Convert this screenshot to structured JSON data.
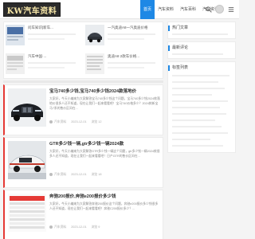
{
  "header": {
    "logo_text": "KW汽车资料",
    "nav": [
      {
        "label": "首页",
        "active": true
      },
      {
        "label": "汽车资料",
        "active": false
      },
      {
        "label": "汽车百科",
        "active": false
      },
      {
        "label": "汽车资讯",
        "active": false
      }
    ],
    "icons": [
      "search-icon",
      "avatar",
      "menu-icon"
    ]
  },
  "top_cards": [
    {
      "title": "问车知识|新车..."
    },
    {
      "title": "一汽奥迪A8一汽奥迪价格"
    },
    {
      "title": "汽车中国·..."
    },
    {
      "title": "奥迪A8 2款车价格..."
    }
  ],
  "articles": [
    {
      "title": "宝马740多少钱,宝马740多少钱2024款落地价",
      "excerpt": "大家好，今天小编来为大家解答宝马740多少钱这个问题，宝马740多少钱2024款落地价很多人还不知道，现在让我们一起来看看吧！宝马740价格多少？2024款新宝马7系的售价区间在...",
      "meta": [
        "汽车资料",
        "2023-12-01",
        "浏览 12"
      ]
    },
    {
      "title": "GTR多少钱一辆,gtr多少钱一辆2024款",
      "excerpt": "大家好，今天小编来为大家解答GTR多少钱一辆这个问题，gtr多少钱一辆2024款很多人还不知道，现在让我们一起来看看吧！日产GTR的售价区间在...",
      "meta": [
        "汽车资料",
        "2023-12-01",
        "浏览 18"
      ]
    },
    {
      "title": "奔驰200报价,奔驰e200报价多少钱",
      "excerpt": "大家好，今天小编来为大家解答奔驰200报价这个问题，奔驰e200报价多少钱很多人还不知道，现在让我们一起来看看吧！奔驰C200报价多少？...",
      "meta": [
        "汽车资料",
        "2023-12-01",
        "浏览 9"
      ]
    }
  ],
  "sidebar": {
    "boxes": [
      {
        "title": "热门文章"
      },
      {
        "title": "最新评论"
      },
      {
        "title": "标签列表"
      }
    ]
  }
}
